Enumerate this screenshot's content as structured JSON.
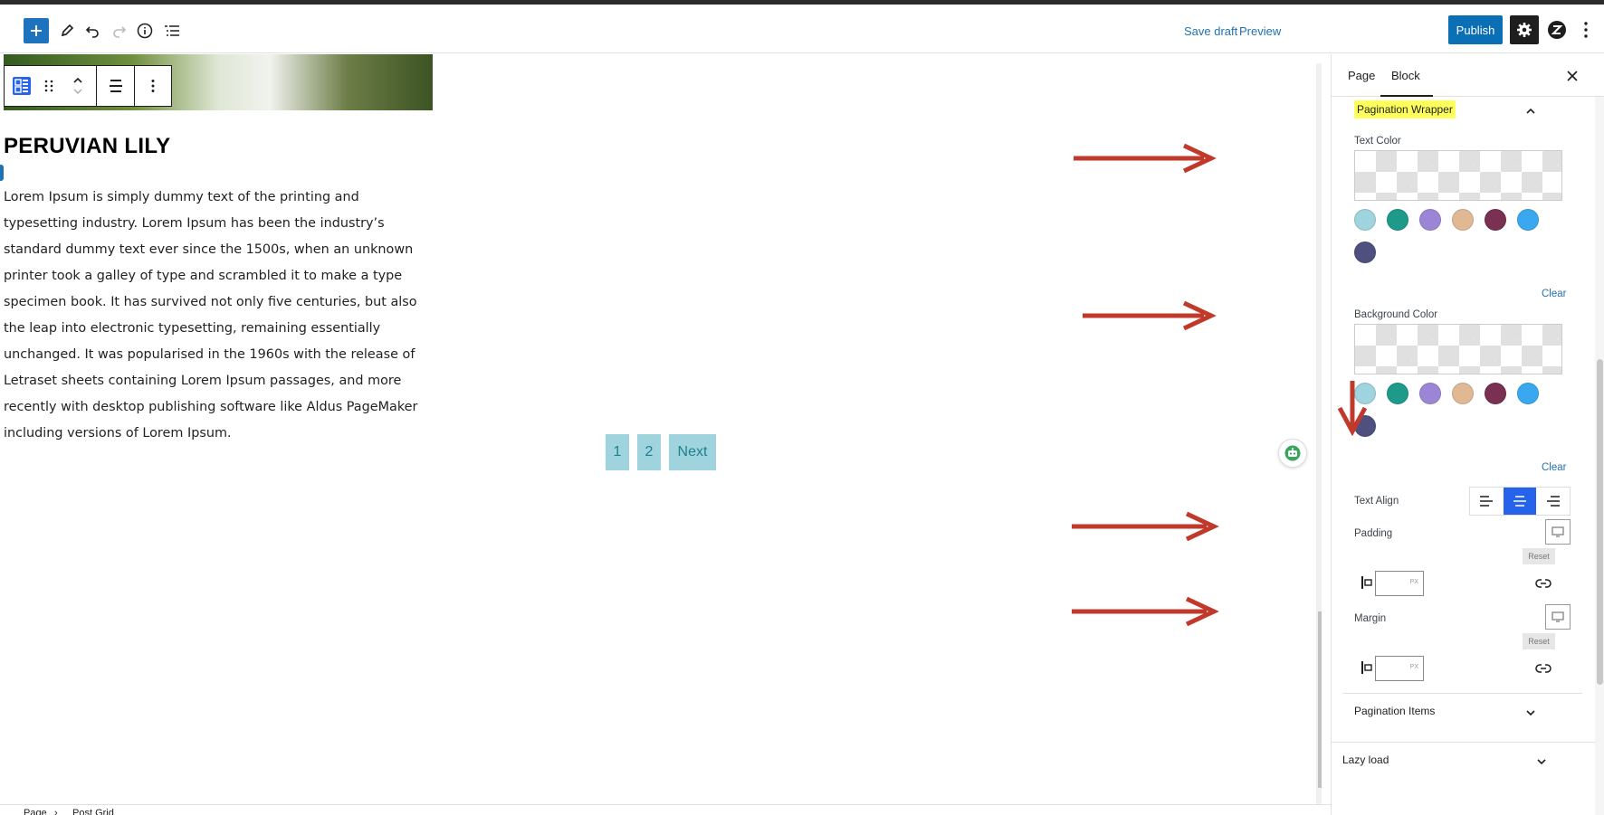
{
  "topbar": {
    "save_draft": "Save draft",
    "preview": "Preview",
    "publish": "Publish",
    "icons": [
      "plus-icon",
      "pencil-icon",
      "undo-icon",
      "redo-icon",
      "info-icon",
      "list-view-icon",
      "gear-icon",
      "plugin-icon",
      "more-vertical-icon"
    ]
  },
  "canvas": {
    "post_title": "PERUVIAN LILY",
    "post_body": "Lorem Ipsum is simply dummy text of the printing and typesetting industry. Lorem Ipsum has been the industry’s standard dummy text ever since the 1500s, when an unknown printer took a galley of type and scrambled it to make a type specimen book. It has survived not only five centuries, but also the leap into electronic typesetting, remaining essentially unchanged. It was popularised in the 1960s with the release of Letraset sheets containing Lorem Ipsum passages, and more recently with desktop publishing software like Aldus PageMaker including versions of Lorem Ipsum.",
    "pagination": [
      "1",
      "2",
      "Next"
    ]
  },
  "breadcrumb": [
    "Page",
    "Post Grid"
  ],
  "sidebar": {
    "tabs": [
      "Page",
      "Block"
    ],
    "active_tab": "Block",
    "pagination_wrapper": "Pagination Wrapper",
    "text_color_label": "Text Color",
    "background_color_label": "Background Color",
    "clear": "Clear",
    "text_align_label": "Text Align",
    "text_align_selected": "center",
    "padding_label": "Padding",
    "margin_label": "Margin",
    "reset": "Reset",
    "unit": "PX",
    "pagination_items": "Pagination Items",
    "lazy_load": "Lazy load",
    "palette": [
      "#9fd4de",
      "#1e9a8a",
      "#9b86d6",
      "#e0b894",
      "#7a3050",
      "#3aa8ef",
      "#4e5180"
    ]
  },
  "colors": {
    "accent": "#2271b1",
    "annotation_arrow": "#c0392b",
    "highlight": "#ffff5c",
    "pagination_bg": "#9fd4de"
  }
}
